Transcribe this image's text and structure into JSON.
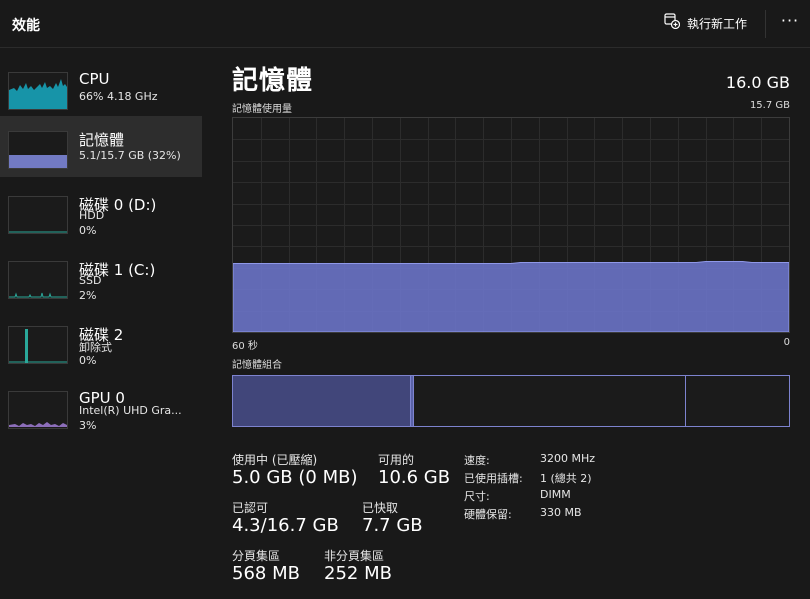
{
  "header": {
    "title": "效能",
    "run_task_label": "執行新工作",
    "more_label": "···"
  },
  "sidebar": {
    "items": [
      {
        "name": "CPU",
        "sub": [
          "66% 4.18 GHz"
        ],
        "color": "#17a2b8"
      },
      {
        "name": "記憶體",
        "sub": [
          "5.1/15.7 GB (32%)"
        ],
        "color": "#7c85d6"
      },
      {
        "name": "磁碟 0 (D:)",
        "sub": [
          "HDD",
          "0%"
        ],
        "color": "#2aa89a"
      },
      {
        "name": "磁碟 1 (C:)",
        "sub": [
          "SSD",
          "2%"
        ],
        "color": "#2aa89a"
      },
      {
        "name": "磁碟 2",
        "sub": [
          "卸除式",
          "0%"
        ],
        "color": "#2aa89a"
      },
      {
        "name": "GPU 0",
        "sub": [
          "Intel(R) UHD Gra...",
          "3%"
        ],
        "color": "#a07cd6"
      }
    ]
  },
  "main": {
    "title": "記憶體",
    "total": "16.0 GB",
    "graph_label": "記憶體使用量",
    "graph_max": "15.7 GB",
    "axis_left": "60 秒",
    "axis_right": "0",
    "composition_label": "記憶體組合",
    "graph_usage_fraction": 0.32,
    "composition": {
      "in_use_fraction": 0.32,
      "modified_fraction": 0.006,
      "standby_fraction": 0.49
    }
  },
  "stats": {
    "in_use": {
      "label": "使用中 (已壓縮)",
      "value": "5.0 GB (0 MB)"
    },
    "available": {
      "label": "可用的",
      "value": "10.6 GB"
    },
    "committed": {
      "label": "已認可",
      "value": "4.3/16.7 GB"
    },
    "cached": {
      "label": "已快取",
      "value": "7.7 GB"
    },
    "paged_pool": {
      "label": "分頁集區",
      "value": "568 MB"
    },
    "non_paged_pool": {
      "label": "非分頁集區",
      "value": "252 MB"
    }
  },
  "details": [
    {
      "label": "速度:",
      "value": "3200 MHz"
    },
    {
      "label": "已使用插槽:",
      "value": "1 (總共 2)"
    },
    {
      "label": "尺寸:",
      "value": "DIMM"
    },
    {
      "label": "硬體保留:",
      "value": "330 MB"
    }
  ]
}
